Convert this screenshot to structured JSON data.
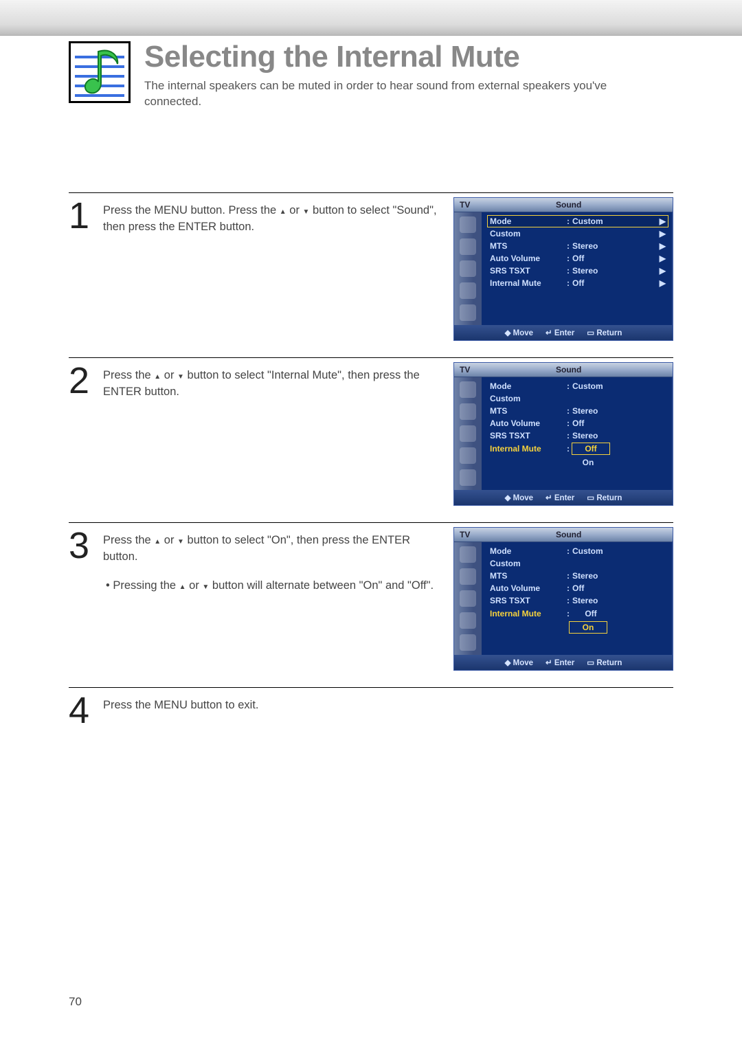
{
  "page_number": "70",
  "title": "Selecting the Internal Mute",
  "description": "The internal speakers can be muted in order to hear sound from external speakers you've connected.",
  "arrow_up": "▲",
  "arrow_down": "▼",
  "steps": [
    {
      "num": "1",
      "text_a": "Press the MENU button. Press the ",
      "text_b": " or ",
      "text_c": " button to select \"Sound\", then press the ENTER button."
    },
    {
      "num": "2",
      "text_a": "Press the ",
      "text_b": " or ",
      "text_c": " button to select \"Internal Mute\", then press the ENTER button."
    },
    {
      "num": "3",
      "text_a": "Press the ",
      "text_b": " or ",
      "text_c": " button to select \"On\", then press the ENTER button.",
      "bullet_a": "• Pressing the ",
      "bullet_b": " or ",
      "bullet_c": " button will alternate between \"On\" and \"Off\"."
    },
    {
      "num": "4",
      "text": "Press the MENU button to exit."
    }
  ],
  "osd_common": {
    "tv": "TV",
    "title": "Sound",
    "footer_move": "Move",
    "footer_enter": "Enter",
    "footer_return": "Return",
    "rows": {
      "mode": "Mode",
      "custom": "Custom",
      "mts": "MTS",
      "auto_volume": "Auto Volume",
      "srs": "SRS TSXT",
      "internal_mute": "Internal Mute"
    },
    "vals": {
      "custom": "Custom",
      "stereo": "Stereo",
      "off": "Off",
      "on": "On"
    },
    "colon": ":",
    "tri": "▶"
  }
}
